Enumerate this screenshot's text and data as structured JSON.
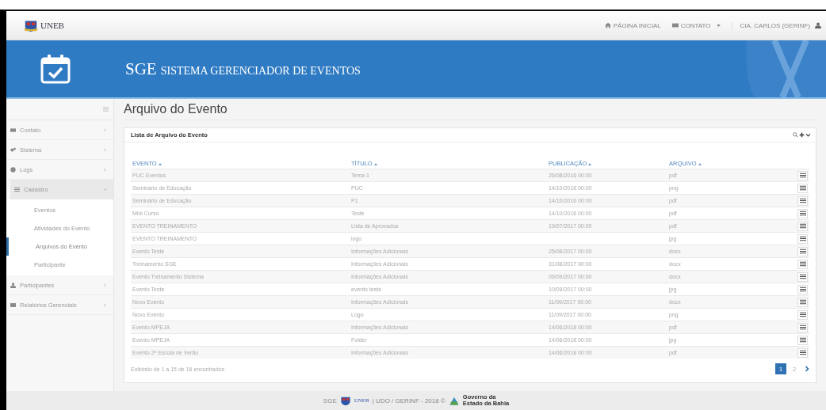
{
  "top_nav": {
    "logo": "UNEB",
    "links": [
      {
        "label": "PÁGINA INICIAL",
        "kind": "home"
      },
      {
        "label": "CONTATO",
        "kind": "mail"
      }
    ],
    "user": "CIA. CARLOS (GERINF)"
  },
  "banner": {
    "abbr": "SGE",
    "title": "SISTEMA GERENCIADOR DE EVENTOS"
  },
  "sidebar": {
    "items": [
      {
        "label": "Contato",
        "kind": "mail",
        "expanded": false,
        "selected": false
      },
      {
        "label": "Sistema",
        "kind": "gears",
        "expanded": false,
        "selected": false
      },
      {
        "label": "Logs",
        "kind": "info",
        "expanded": false,
        "selected": false
      },
      {
        "label": "Cadastro",
        "kind": "list",
        "expanded": true,
        "selected": false,
        "children": [
          {
            "label": "Eventos",
            "selected": false
          },
          {
            "label": "Atividades do Evento",
            "selected": false
          },
          {
            "label": "Arquivos do Evento",
            "selected": true
          },
          {
            "label": "Participante",
            "selected": false
          }
        ]
      },
      {
        "label": "Participantes",
        "kind": "user",
        "expanded": false,
        "selected": false
      },
      {
        "label": "Relatórios Gerenciais",
        "kind": "card",
        "expanded": false,
        "selected": false
      }
    ]
  },
  "page_title": "Arquivo do Evento",
  "panel": {
    "title": "Lista de Arquivo do Evento",
    "table": {
      "columns": [
        "EVENTO",
        "TÍTULO",
        "PUBLICAÇÃO",
        "ARQUIVO"
      ],
      "rows": [
        [
          "PUC Eventos",
          "Tema 1",
          "26/08/2016 00:00",
          "pdf"
        ],
        [
          "Seminário de Educação",
          "PUC",
          "14/10/2016 00:00",
          "png"
        ],
        [
          "Seminário de Educação",
          "P1",
          "14/10/2016 00:00",
          "pdf"
        ],
        [
          "Mini Curso",
          "Teste",
          "14/10/2016 00:00",
          "pdf"
        ],
        [
          "EVENTO TREINAMENTO",
          "Lista de Aprovados",
          "19/07/2017 00:00",
          "pdf"
        ],
        [
          "EVENTO TREINAMENTO",
          "logo",
          "",
          "jpg"
        ],
        [
          "Evento Teste",
          "Informações Adicionais",
          "25/08/2017 00:00",
          "docx"
        ],
        [
          "Treinamento SGE",
          "Informações Adicionais",
          "31/08/2017 00:00",
          "docx"
        ],
        [
          "Evento Treinamento Sistema",
          "Informações Adicionais",
          "06/09/2017 00:00",
          "docx"
        ],
        [
          "Evento Teste",
          "evento teste",
          "10/09/2017 00:00",
          "jpg"
        ],
        [
          "Novo Evento",
          "Informações Adicionais",
          "11/09/2017 00:00",
          "docx"
        ],
        [
          "Novo Evento",
          "Logo",
          "11/09/2017 00:00",
          "png"
        ],
        [
          "Evento MPEJA",
          "Informações Adicionais",
          "14/06/2018 00:00",
          "pdf"
        ],
        [
          "Evento MPEJA",
          "Folder",
          "14/06/2018 00:00",
          "jpg"
        ],
        [
          "Evento 2ª Escola de Verão",
          "Informações Adicionais",
          "14/06/2018 00:00",
          "pdf"
        ]
      ]
    },
    "info": "Exibindo de 1 a 15 de 16 encontrados",
    "pages": [
      {
        "label": "1",
        "selected": true
      },
      {
        "label": "2",
        "selected": false
      }
    ]
  },
  "footer": {
    "abbr": "SGE",
    "logo": "UNEB",
    "credit": "| UDO / GERINF - 2018 ©",
    "gov_line1": "Governo da",
    "gov_line2": "Estado da Bahia"
  }
}
